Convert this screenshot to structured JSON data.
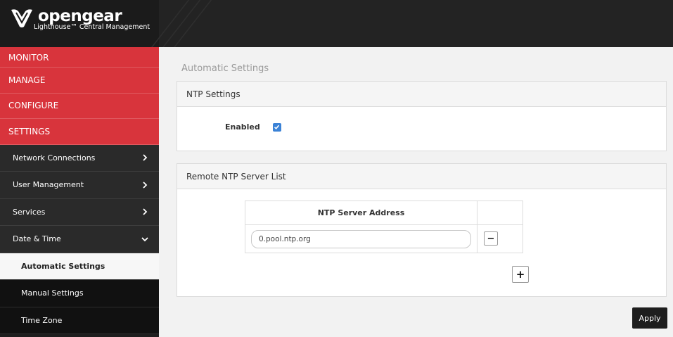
{
  "brand": {
    "name": "opengear",
    "subtitle": "Lighthouse™ Central Management"
  },
  "colors": {
    "accent_red": "#d8343c",
    "header_bg": "#232323",
    "sidebar_bg": "#1e1e1e",
    "checkbox_blue": "#3b82d6"
  },
  "sidebar": {
    "sections": [
      {
        "label": "MONITOR"
      },
      {
        "label": "MANAGE"
      },
      {
        "label": "CONFIGURE"
      },
      {
        "label": "SETTINGS"
      }
    ],
    "items": [
      {
        "label": "Network Connections",
        "icon": "chevron-right-icon"
      },
      {
        "label": "User Management",
        "icon": "chevron-right-icon"
      },
      {
        "label": "Services",
        "icon": "chevron-right-icon"
      },
      {
        "label": "Date & Time",
        "icon": "chevron-down-icon"
      }
    ],
    "subitems": [
      {
        "label": "Automatic Settings",
        "active": true
      },
      {
        "label": "Manual Settings",
        "active": false
      },
      {
        "label": "Time Zone",
        "active": false
      }
    ]
  },
  "main": {
    "title": "Automatic Settings",
    "ntp_panel": {
      "title": "NTP Settings",
      "enabled_label": "Enabled",
      "enabled": true
    },
    "server_panel": {
      "title": "Remote NTP Server List",
      "column_header": "NTP Server Address",
      "servers": [
        "0.pool.ntp.org"
      ],
      "remove_label": "−",
      "add_label": "+"
    },
    "apply_label": "Apply"
  }
}
